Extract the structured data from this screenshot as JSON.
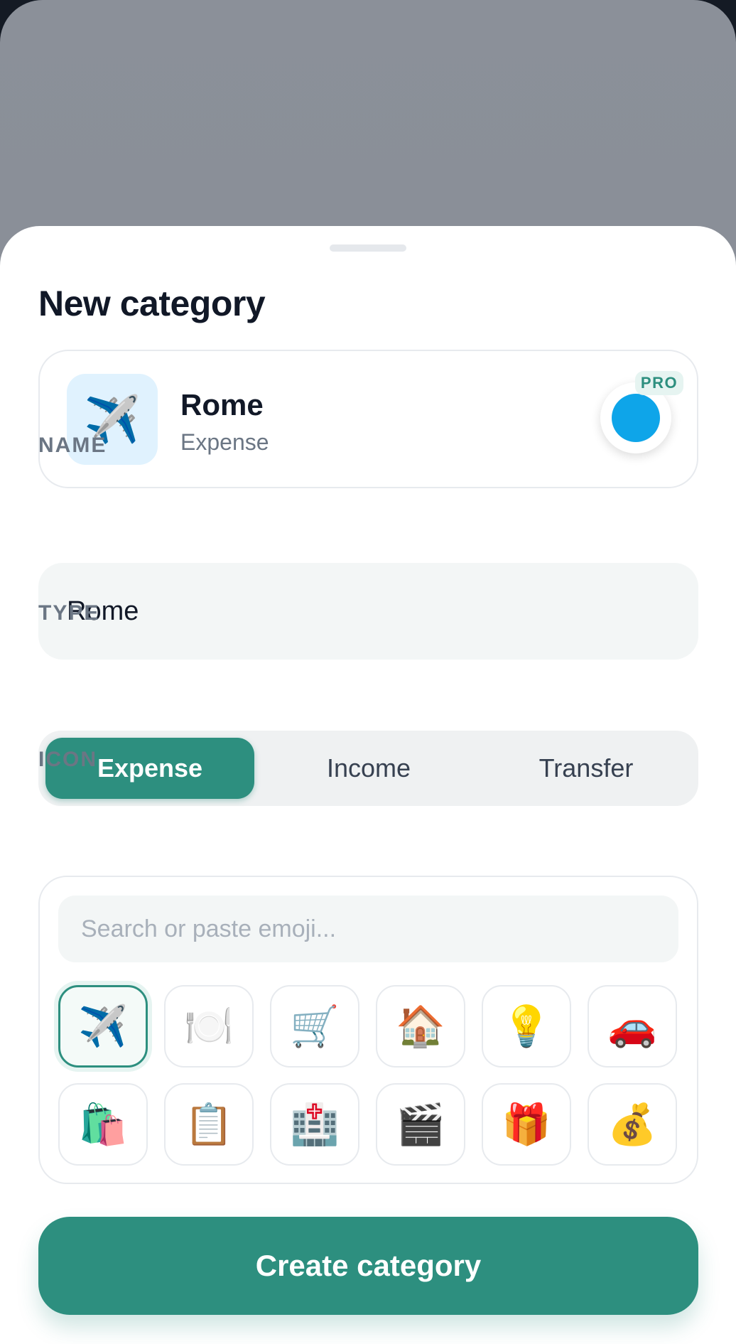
{
  "sheet": {
    "title": "New category"
  },
  "preview": {
    "icon": "✈️",
    "name": "Rome",
    "type": "Expense",
    "color": "#0ea5e9",
    "badge": "PRO"
  },
  "name_section": {
    "label": "NAME",
    "value": "Rome"
  },
  "type_section": {
    "label": "TYPE",
    "options": [
      "Expense",
      "Income",
      "Transfer"
    ],
    "selected": "Expense"
  },
  "icon_section": {
    "label": "ICON",
    "search_placeholder": "Search or paste emoji...",
    "emojis": [
      "✈️",
      "🍽️",
      "🛒",
      "🏠",
      "💡",
      "🚗",
      "🛍️",
      "📋",
      "🏥",
      "🎬",
      "🎁",
      "💰"
    ],
    "selected": "✈️"
  },
  "actions": {
    "create_label": "Create category"
  },
  "colors": {
    "accent": "#2d8f7f",
    "selected_color": "#0ea5e9"
  }
}
